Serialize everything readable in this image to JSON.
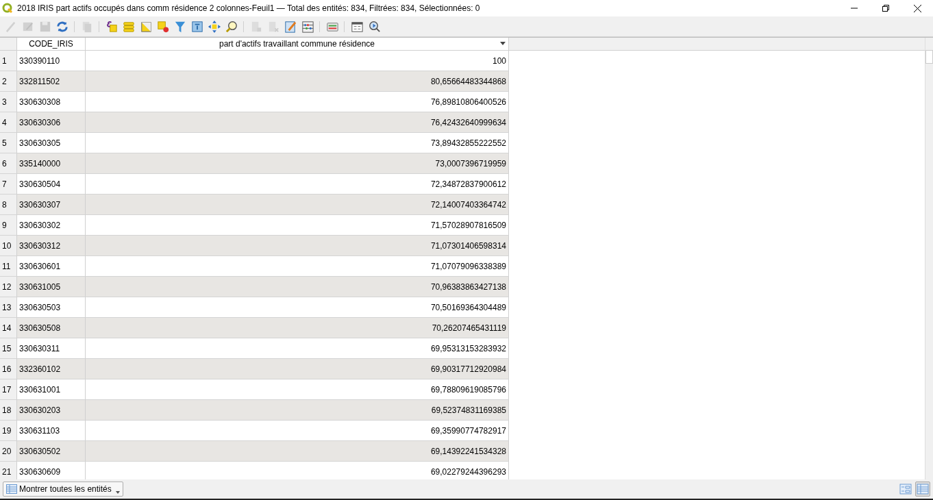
{
  "window": {
    "title": "2018 IRIS part actifs occupés dans comm résidence 2 colonnes-Feuil1 — Total des entités: 834, Filtrées: 834, Sélectionnées: 0"
  },
  "toolbar": [
    {
      "kind": "pencil",
      "disabled": true
    },
    {
      "kind": "multi-edit",
      "disabled": true
    },
    {
      "kind": "save",
      "disabled": true
    },
    {
      "kind": "refresh",
      "disabled": false
    },
    {
      "kind": "separator"
    },
    {
      "kind": "copy",
      "disabled": true
    },
    {
      "kind": "separator"
    },
    {
      "kind": "expression",
      "disabled": false
    },
    {
      "kind": "select-all",
      "disabled": false
    },
    {
      "kind": "invert",
      "disabled": false
    },
    {
      "kind": "deselect",
      "disabled": false
    },
    {
      "kind": "filter",
      "disabled": false
    },
    {
      "kind": "move-top",
      "disabled": false
    },
    {
      "kind": "pan",
      "disabled": false
    },
    {
      "kind": "zoom",
      "disabled": false
    },
    {
      "kind": "separator"
    },
    {
      "kind": "add-field",
      "disabled": true
    },
    {
      "kind": "delete-field",
      "disabled": true
    },
    {
      "kind": "calculator",
      "disabled": false
    },
    {
      "kind": "conditional",
      "disabled": false
    },
    {
      "kind": "separator"
    },
    {
      "kind": "dock",
      "disabled": false
    },
    {
      "kind": "separator"
    },
    {
      "kind": "form",
      "disabled": false
    },
    {
      "kind": "actions",
      "disabled": false
    }
  ],
  "table": {
    "columns": [
      {
        "label": "CODE_IRIS",
        "sorted_descending": false
      },
      {
        "label": "part d'actifs travaillant commune résidence",
        "sorted_descending": true
      }
    ],
    "rows": [
      {
        "number": "1",
        "cells": [
          "330390110",
          "100"
        ]
      },
      {
        "number": "2",
        "cells": [
          "332811502",
          "80,65664483344868"
        ]
      },
      {
        "number": "3",
        "cells": [
          "330630308",
          "76,89810806400526"
        ]
      },
      {
        "number": "4",
        "cells": [
          "330630306",
          "76,42432640999634"
        ]
      },
      {
        "number": "5",
        "cells": [
          "330630305",
          "73,89432855222552"
        ]
      },
      {
        "number": "6",
        "cells": [
          "335140000",
          "73,0007396719959"
        ]
      },
      {
        "number": "7",
        "cells": [
          "330630504",
          "72,34872837900612"
        ]
      },
      {
        "number": "8",
        "cells": [
          "330630307",
          "72,14007403364742"
        ]
      },
      {
        "number": "9",
        "cells": [
          "330630302",
          "71,57028907816509"
        ]
      },
      {
        "number": "10",
        "cells": [
          "330630312",
          "71,07301406598314"
        ]
      },
      {
        "number": "11",
        "cells": [
          "330630601",
          "71,07079096338389"
        ]
      },
      {
        "number": "12",
        "cells": [
          "330631005",
          "70,96383863427138"
        ]
      },
      {
        "number": "13",
        "cells": [
          "330630503",
          "70,50169364304489"
        ]
      },
      {
        "number": "14",
        "cells": [
          "330630508",
          "70,26207465431119"
        ]
      },
      {
        "number": "15",
        "cells": [
          "330630311",
          "69,95313153283932"
        ]
      },
      {
        "number": "16",
        "cells": [
          "332360102",
          "69,90317712920984"
        ]
      },
      {
        "number": "17",
        "cells": [
          "330631001",
          "69,78809619085796"
        ]
      },
      {
        "number": "18",
        "cells": [
          "330630203",
          "69,52374831169385"
        ]
      },
      {
        "number": "19",
        "cells": [
          "330631103",
          "69,35990774782917"
        ]
      },
      {
        "number": "20",
        "cells": [
          "330630502",
          "69,14392241534328"
        ]
      },
      {
        "number": "21",
        "cells": [
          "330630609",
          "69,02279244396293"
        ]
      }
    ]
  },
  "bottom_bar": {
    "filter_button": "Montrer toutes les entités",
    "views": [
      {
        "kind": "form",
        "selected": false
      },
      {
        "kind": "table",
        "selected": true
      }
    ]
  }
}
